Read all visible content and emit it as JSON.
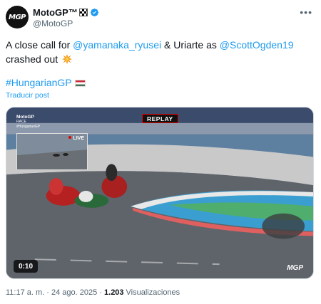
{
  "author": {
    "display_name": "MotoGP™",
    "handle": "@MotoGP",
    "avatar_text": "MGP"
  },
  "tweet": {
    "text_prefix": "A close call for ",
    "mention_1": "@yamanaka_ryusei",
    "text_middle": " & Uriarte as ",
    "mention_2": "@ScottOgden19",
    "text_suffix": " crashed out",
    "hashtag": "#HungarianGP",
    "translate_label": "Traducir post"
  },
  "video": {
    "replay_label": "REPLAY",
    "live_label": "LIVE",
    "broadcast_logo": "MotoGP",
    "broadcast_sub_1": "RACE",
    "broadcast_sub_2": "#HungarianGP",
    "time": "0:10",
    "corner_logo": "MGP"
  },
  "meta": {
    "time": "11:17 a. m. · 24 ago. 2025 · ",
    "views_count": "1.203",
    "views_label": "Visualizaciones"
  },
  "icons": [
    "verified-icon",
    "chequered-flag-icon",
    "more-icon",
    "explosion-icon",
    "hungary-flag-icon"
  ],
  "colors": {
    "link": "#1d9bf0",
    "secondary_text": "#536471",
    "verified": "#1d9bf0",
    "brand_red": "#e10600"
  }
}
